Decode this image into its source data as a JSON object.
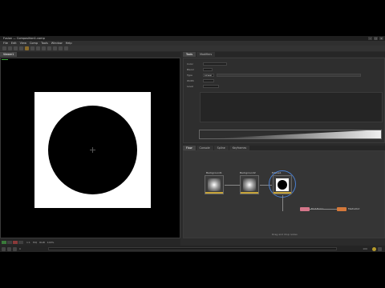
{
  "window": {
    "title": "Fusion — Composition1.comp",
    "buttons": [
      "–",
      "□",
      "×"
    ]
  },
  "menubar": {
    "items": [
      "File",
      "Edit",
      "View",
      "Comp",
      "Tools",
      "Window",
      "Help"
    ]
  },
  "viewer": {
    "tabs": [
      "Viewer1"
    ],
    "status": [
      "1:1",
      "HiQ",
      "RGB",
      "100%"
    ]
  },
  "inspector": {
    "tabs": [
      "Tools",
      "Modifiers"
    ],
    "rows": [
      {
        "label": "Color",
        "value": ""
      },
      {
        "label": "Blend",
        "value": ""
      },
      {
        "label": "Type",
        "value": "Linear"
      },
      {
        "label": "Width",
        "value": ""
      },
      {
        "label": "Level",
        "value": ""
      }
    ]
  },
  "nodegraph": {
    "tabs": [
      "Flow",
      "Console",
      "Spline",
      "Keyframes"
    ],
    "nodes": [
      {
        "label": "Background1"
      },
      {
        "label": "Background2"
      },
      {
        "label": "Ellipse1"
      }
    ],
    "extra_nodes": [
      {
        "label": "Fast Noise",
        "color": "#d4768a"
      },
      {
        "label": "MediaOut",
        "color": "#d4783a"
      }
    ],
    "hint": "Drag and drop nodes"
  },
  "colors": {
    "selection": "#4a7fd0",
    "node_foot": "#c8a53a",
    "merge_pink": "#d4768a",
    "out_orange": "#d4783a"
  },
  "statusbar": {
    "frame_start": "0",
    "frame_end": "100"
  }
}
